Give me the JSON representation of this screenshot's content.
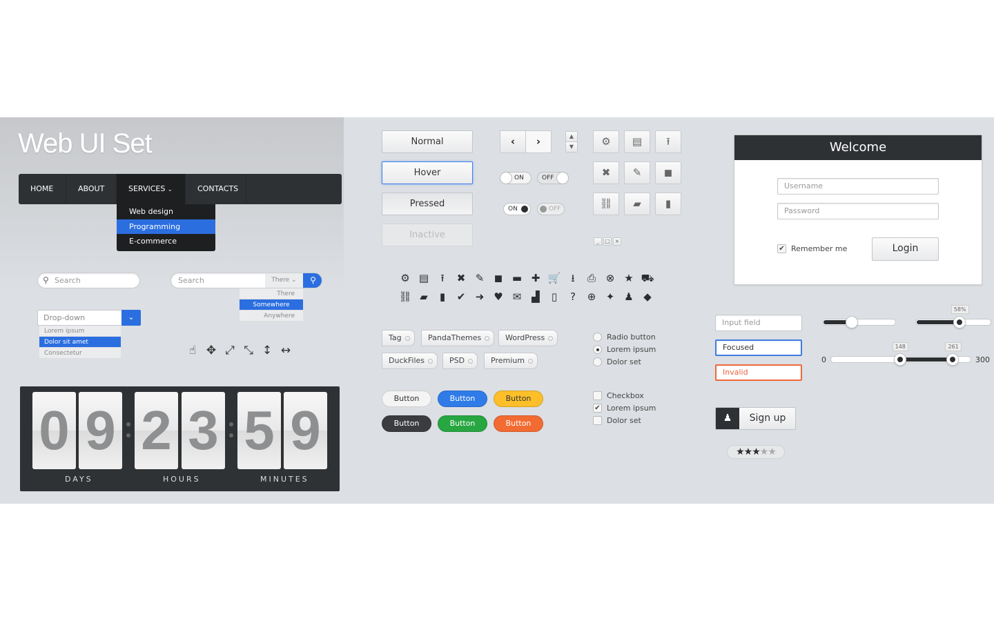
{
  "title": "Web UI Set",
  "nav": {
    "items": [
      "HOME",
      "ABOUT",
      "SERVICES",
      "CONTACTS"
    ],
    "submenu": [
      "Web design",
      "Programming",
      "E-commerce"
    ],
    "submenu_selected": "Programming"
  },
  "search1": {
    "placeholder": "Search"
  },
  "search2": {
    "placeholder": "Search",
    "scope": "There",
    "options": [
      "There",
      "Somewhere",
      "Anywhere"
    ],
    "selected": "Somewhere"
  },
  "dropdown": {
    "value": "Drop-down",
    "options": [
      "Lorem ipsum",
      "Dolor sit amet",
      "Consectetur"
    ],
    "selected": "Dolor sit amet"
  },
  "cursors": [
    "hand-cursor-icon",
    "move-cursor-icon",
    "resize-diagonal-ne-icon",
    "resize-diagonal-nw-icon",
    "resize-vertical-icon",
    "resize-horizontal-icon"
  ],
  "countdown": {
    "digits": [
      "0",
      "9",
      "2",
      "3",
      "5",
      "9"
    ],
    "labels": [
      "DAYS",
      "HOURS",
      "MINUTES"
    ]
  },
  "buttons": {
    "normal": "Normal",
    "hover": "Hover",
    "pressed": "Pressed",
    "inactive": "Inactive"
  },
  "toggles": {
    "on": "ON",
    "off": "OFF"
  },
  "tool_icons": [
    "gears-icon",
    "window-icon",
    "upload-icon",
    "close-icon",
    "pencil-icon",
    "cube-icon",
    "link-icon",
    "folder-icon",
    "file-icon"
  ],
  "icons_row1": [
    [
      "gears-icon",
      "⚙"
    ],
    [
      "window-icon",
      "▤"
    ],
    [
      "upload-icon",
      "⭱"
    ],
    [
      "close-icon",
      "✖"
    ],
    [
      "pencil-icon",
      "✎"
    ],
    [
      "cube-icon",
      "◼"
    ],
    [
      "minus-icon",
      "▬"
    ],
    [
      "plus-icon",
      "✚"
    ],
    [
      "cart-icon",
      "🛒"
    ],
    [
      "download-icon",
      "⭳"
    ],
    [
      "print-icon",
      "⎙"
    ],
    [
      "close-circle-icon",
      "⊗"
    ],
    [
      "star-icon",
      "★"
    ],
    [
      "truck-icon",
      "⛟"
    ]
  ],
  "icons_row2": [
    [
      "link-icon",
      "⛓"
    ],
    [
      "folder-icon",
      "▰"
    ],
    [
      "file-icon",
      "▮"
    ],
    [
      "check-icon",
      "✔"
    ],
    [
      "arrow-right-icon",
      "➜"
    ],
    [
      "heart-icon",
      "♥"
    ],
    [
      "mail-icon",
      "✉"
    ],
    [
      "chart-icon",
      "▟"
    ],
    [
      "phone-icon",
      "▯"
    ],
    [
      "help-icon",
      "?"
    ],
    [
      "lifebuoy-icon",
      "⊕"
    ],
    [
      "pin-icon",
      "✦"
    ],
    [
      "user-icon",
      "♟"
    ],
    [
      "tag-icon",
      "◆"
    ]
  ],
  "tags": [
    "Tag",
    "PandaThemes",
    "WordPress",
    "DuckFiles",
    "PSD",
    "Premium"
  ],
  "pill_buttons": [
    "Button",
    "Button",
    "Button",
    "Button",
    "Button",
    "Button"
  ],
  "colors": {
    "white": "#f4f4f4",
    "blue": "#2f7be8",
    "yellow": "#fcbf2a",
    "dark": "#3a3c3f",
    "green": "#27a642",
    "orange": "#f26b32",
    "accent": "#2b6ee0"
  },
  "radios": {
    "items": [
      "Radio button",
      "Lorem ipsum",
      "Dolor set"
    ],
    "selected": "Lorem ipsum"
  },
  "checkboxes": {
    "items": [
      "Checkbox",
      "Lorem ipsum",
      "Dolor set"
    ],
    "checked": [
      "Lorem ipsum"
    ]
  },
  "login": {
    "title": "Welcome",
    "username_placeholder": "Username",
    "password_placeholder": "Password",
    "remember": "Remember me",
    "remember_checked": true,
    "button": "Login"
  },
  "fields": {
    "input": "Input field",
    "focused": "Focused",
    "invalid": "Invalid"
  },
  "signup": "Sign up",
  "rating": {
    "value": 3,
    "max": 5
  },
  "sliders": {
    "simple": {
      "percent": 40
    },
    "labeled": {
      "label": "58%",
      "percent": 58
    },
    "range": {
      "min": "0",
      "max": "300",
      "low": "148",
      "high": "261"
    }
  }
}
